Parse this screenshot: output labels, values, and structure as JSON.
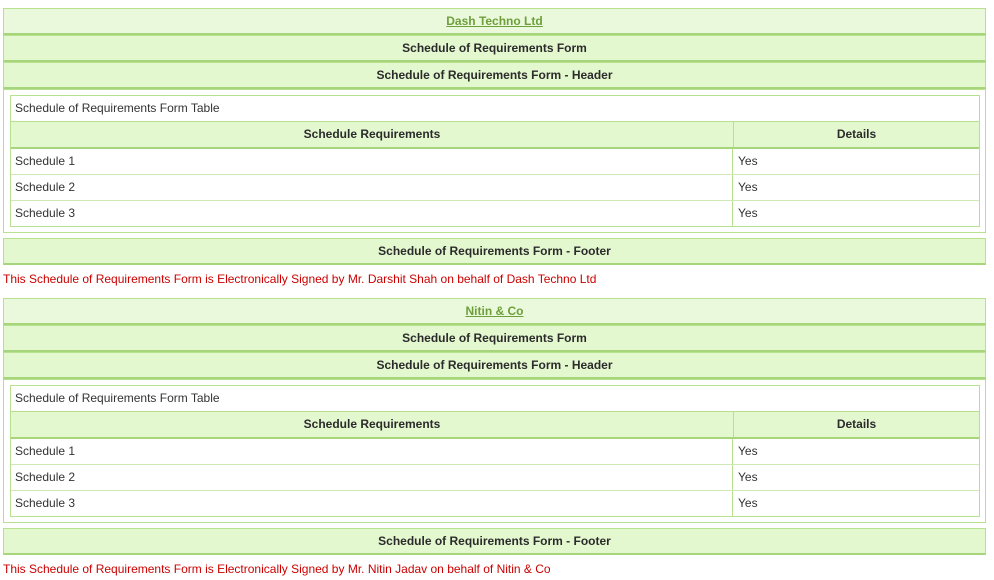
{
  "sections": [
    {
      "company": "Dash Techno Ltd",
      "form_title": "Schedule of Requirements Form",
      "form_header": "Schedule of Requirements Form - Header",
      "table_caption": "Schedule of Requirements Form Table",
      "columns": [
        "Schedule Requirements",
        "Details"
      ],
      "rows": [
        [
          "Schedule 1",
          "Yes"
        ],
        [
          "Schedule 2",
          "Yes"
        ],
        [
          "Schedule 3",
          "Yes"
        ]
      ],
      "form_footer": "Schedule of Requirements Form - Footer",
      "signature": "This Schedule of Requirements Form is Electronically Signed by Mr. Darshit Shah on behalf of Dash Techno Ltd"
    },
    {
      "company": "Nitin & Co",
      "form_title": "Schedule of Requirements Form",
      "form_header": "Schedule of Requirements Form - Header",
      "table_caption": "Schedule of Requirements Form Table",
      "columns": [
        "Schedule Requirements",
        "Details"
      ],
      "rows": [
        [
          "Schedule 1",
          "Yes"
        ],
        [
          "Schedule 2",
          "Yes"
        ],
        [
          "Schedule 3",
          "Yes"
        ]
      ],
      "form_footer": "Schedule of Requirements Form - Footer",
      "signature": "This Schedule of Requirements Form is Electronically Signed by Mr. Nitin Jadav on behalf of Nitin & Co"
    }
  ],
  "colors": {
    "header_bg": "#e4f8d0",
    "border": "#b7e08f",
    "company_link": "#6e9f3a",
    "signature_text": "#cc0000"
  }
}
